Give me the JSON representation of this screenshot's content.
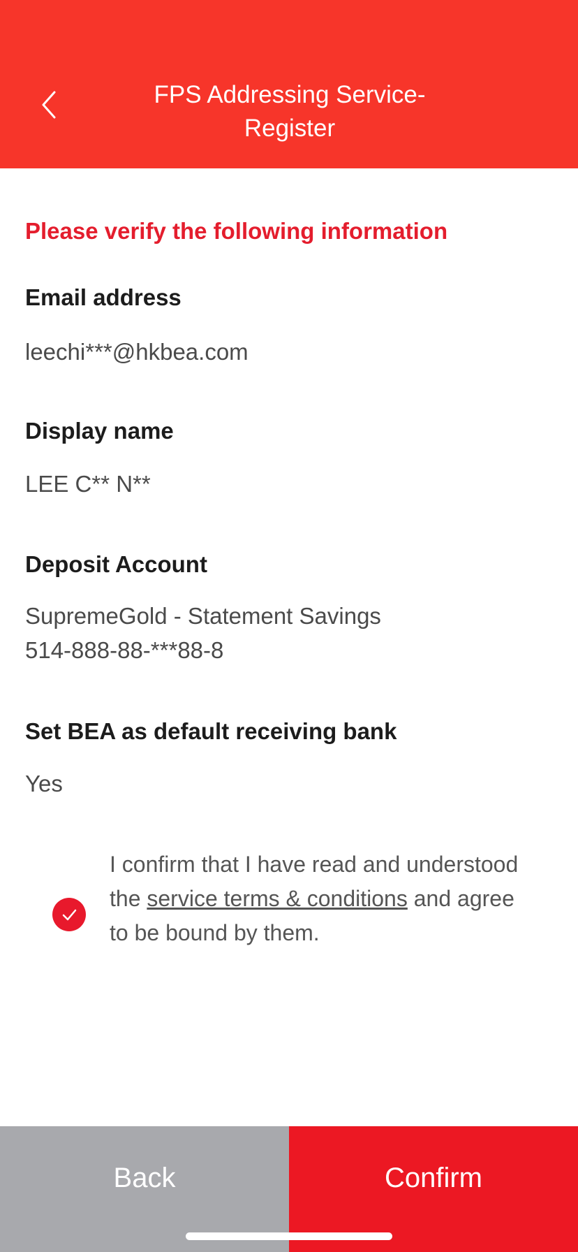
{
  "header": {
    "title_line1": "FPS Addressing Service-",
    "title_line2": "Register"
  },
  "content": {
    "heading": "Please verify the following information",
    "fields": [
      {
        "label": "Email address",
        "value_lines": [
          "leechi***@hkbea.com"
        ]
      },
      {
        "label": "Display name",
        "value_lines": [
          "LEE C** N**"
        ]
      },
      {
        "label": "Deposit Account",
        "value_lines": [
          "SupremeGold - Statement Savings",
          "514-888-88-***88-8"
        ]
      },
      {
        "label": "Set BEA as default receiving bank",
        "value_lines": [
          "Yes"
        ]
      }
    ]
  },
  "confirmation": {
    "checked": true,
    "text_before": "I confirm that I have read and understood the ",
    "link_text": "service terms & conditions",
    "text_after": " and agree to be bound by them."
  },
  "buttons": {
    "back_label": "Back",
    "confirm_label": "Confirm"
  },
  "colors": {
    "header_bg": "#f7352a",
    "accent_red": "#e41d2d",
    "back_button_bg": "#a8a9ad",
    "confirm_button_bg": "#ec1823"
  },
  "icons": {
    "back": "chevron-left-icon",
    "check": "checkmark-icon"
  }
}
